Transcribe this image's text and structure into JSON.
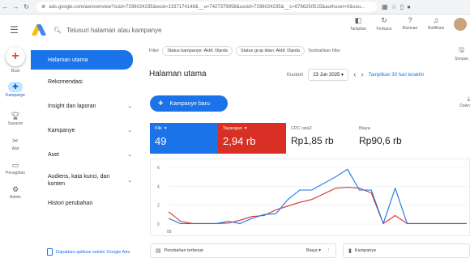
{
  "browser": {
    "url": "ads.google.com/aw/overview?ocid=7296024235&euid=1337174148&__u=7427379958&uscid=7296024235&__c=6786250515&authuser=0&sou...",
    "icons": [
      "back-icon",
      "forward-icon",
      "reload-icon",
      "site-settings-icon",
      "extensions-icon",
      "bookmark-icon",
      "sidebar-icon",
      "profile-icon"
    ]
  },
  "header": {
    "search_placeholder": "Telusuri halaman atau kampanye",
    "tools": [
      {
        "icon": "appearance-icon",
        "label": "Tampilan"
      },
      {
        "icon": "refresh-icon",
        "label": "Perbarui"
      },
      {
        "icon": "help-icon",
        "label": "Bantuan"
      },
      {
        "icon": "bell-icon",
        "label": "Notifikasi"
      }
    ]
  },
  "rail": {
    "create_label": "Buat",
    "items": [
      {
        "icon": "campaigns-icon",
        "label": "Kampanye",
        "active": true
      },
      {
        "icon": "goals-icon",
        "label": "Sasaran"
      },
      {
        "icon": "tools-icon",
        "label": "Alat"
      },
      {
        "icon": "billing-icon",
        "label": "Penagihan"
      },
      {
        "icon": "admin-icon",
        "label": "Admin"
      }
    ]
  },
  "nav": {
    "items": [
      {
        "label": "Halaman utama",
        "active": true
      },
      {
        "label": "Rekomendasi"
      },
      {
        "label": "Insight dan laporan",
        "chevron": true
      },
      {
        "label": "Kampanye",
        "chevron": true
      },
      {
        "label": "Aset",
        "chevron": true
      },
      {
        "label": "Audiens, kata kunci, dan konten",
        "chevron": true
      },
      {
        "label": "Histori perubahan"
      }
    ],
    "promo": "Dapatkan aplikasi seluler Google Ads"
  },
  "filters": {
    "label": "Filter",
    "chips": [
      "Status kampanye: Aktif, Dijeda",
      "Status grup iklan: Aktif, Dijeda"
    ],
    "add_label": "Tambahkan filter",
    "save_label": "Simpan"
  },
  "page": {
    "title": "Halaman utama",
    "date_label": "Kustom",
    "date_value": "23 Jun 2025",
    "show_link": "Tampilkan 30 hari terakhir",
    "new_campaign": "Kampanye baru",
    "download_label": "Down"
  },
  "metrics": [
    {
      "label": "Klik",
      "value": "49",
      "dropdown": true,
      "color": "#1a73e8"
    },
    {
      "label": "Tayangan",
      "value": "2,94 rb",
      "dropdown": true,
      "color": "#d93025"
    },
    {
      "label": "CPC rata2",
      "value": "Rp1,85 rb"
    },
    {
      "label": "Biaya",
      "value": "Rp90,6 rb"
    }
  ],
  "chart_data": {
    "type": "line",
    "y_ticks": [
      "6",
      "4",
      "2",
      "0"
    ],
    "x_tick_label": "00",
    "ylim": [
      0,
      6
    ],
    "series": [
      {
        "color": "#1a73e8",
        "values": [
          0.6,
          0.05,
          0.05,
          0.05,
          0.05,
          0.3,
          0.05,
          0.6,
          1.0,
          1.1,
          2.6,
          3.6,
          3.6,
          4.3,
          5.0,
          5.8,
          3.6,
          3.6,
          0.05,
          3.8,
          0.05,
          0.05,
          0.05,
          0.05,
          0.05,
          0.05
        ]
      },
      {
        "color": "#d93025",
        "values": [
          1.3,
          0.3,
          0.05,
          0.05,
          0.05,
          0.1,
          0.4,
          0.8,
          0.9,
          1.5,
          1.9,
          2.3,
          2.6,
          3.2,
          3.8,
          3.9,
          3.8,
          3.3,
          0.05,
          0.9,
          0.05,
          0.05,
          0.05,
          0.05,
          0.05,
          0.05
        ]
      }
    ]
  },
  "cards": [
    {
      "title": "Perubahan terbesar",
      "sort_label": "Biaya",
      "icon": "changes-icon"
    },
    {
      "title": "Kampanye",
      "icon": "bar-chart-icon"
    }
  ]
}
